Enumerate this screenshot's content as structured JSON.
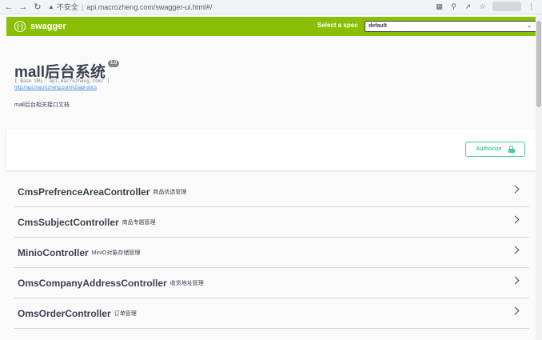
{
  "browser": {
    "back_icon": "arrow-left-icon",
    "forward_icon": "arrow-right-icon",
    "reload_icon": "reload-icon",
    "security_label": "不安全",
    "url": "api.macrozheng.com/swagger-ui.html#/"
  },
  "topbar": {
    "logo_text": "swagger",
    "spec_label": "Select a spec",
    "spec_value": "default",
    "accent_color": "#89bf04"
  },
  "info": {
    "title": "mall后台系统",
    "version": "1.0",
    "base_url": "[ Base URL: api.macrozheng.com/ ]",
    "docs_link": "http://api.macrozheng.com/v2/api-docs",
    "description": "mall后台相关接口文档"
  },
  "auth": {
    "authorize_label": "Authorize",
    "color": "#49cc90"
  },
  "controllers": [
    {
      "name": "CmsPrefrenceAreaController",
      "desc": "商品优选管理"
    },
    {
      "name": "CmsSubjectController",
      "desc": "商品专题管理"
    },
    {
      "name": "MinioController",
      "desc": "MinIO对象存储管理"
    },
    {
      "name": "OmsCompanyAddressController",
      "desc": "收货地址管理"
    },
    {
      "name": "OmsOrderController",
      "desc": "订单管理"
    }
  ]
}
